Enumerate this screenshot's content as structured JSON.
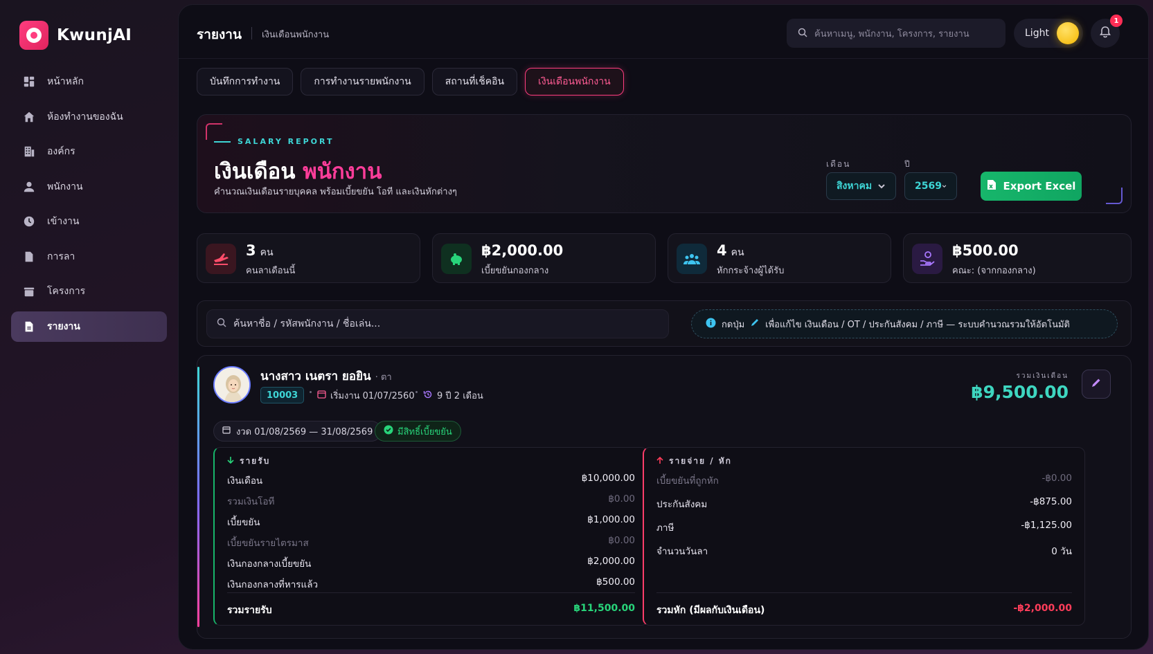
{
  "brand": {
    "name": "KwunjAI"
  },
  "sidebar": {
    "items": [
      {
        "label": "หน้าหลัก",
        "icon": "dashboard-icon"
      },
      {
        "label": "ห้องทำงานของฉัน",
        "icon": "home-icon"
      },
      {
        "label": "องค์กร",
        "icon": "building-icon"
      },
      {
        "label": "พนักงาน",
        "icon": "user-icon"
      },
      {
        "label": "เข้างาน",
        "icon": "clock-icon"
      },
      {
        "label": "การลา",
        "icon": "document-icon"
      },
      {
        "label": "โครงการ",
        "icon": "folder-icon"
      },
      {
        "label": "รายงาน",
        "icon": "report-icon",
        "active": true
      }
    ]
  },
  "header": {
    "title": "รายงาน",
    "breadcrumb": "เงินเดือนพนักงาน",
    "search_placeholder": "ค้นหาเมนู, พนักงาน, โครงการ, รายงาน",
    "theme_label": "Light",
    "notification_count": "1"
  },
  "tabs": [
    {
      "label": "บันทึกการทำงาน"
    },
    {
      "label": "การทำงานรายพนักงาน"
    },
    {
      "label": "สถานที่เช็คอิน"
    },
    {
      "label": "เงินเดือนพนักงาน",
      "active": true
    }
  ],
  "hero": {
    "eyebrow": "SALARY REPORT",
    "title_main": "เงินเดือน",
    "title_accent": "พนักงาน",
    "subtitle": "คำนวณเงินเดือนรายบุคคล พร้อมเบี้ยขยัน โอที และเงินหักต่างๆ",
    "month_label": "เดือน",
    "month_value": "สิงหาคม",
    "year_label": "ปี",
    "year_value": "2569",
    "export_label": "Export Excel",
    "accent_color": "#ff3d9a"
  },
  "stats": [
    {
      "value": "3",
      "unit": "คน",
      "label": "คนลาเดือนนี้",
      "icon": "plane-icon",
      "color": "#ff4d6a"
    },
    {
      "value": "฿2,000.00",
      "unit": "",
      "label": "เบี้ยขยันกองกลาง",
      "icon": "piggy-bank-icon",
      "color": "#28d47a"
    },
    {
      "value": "4",
      "unit": "คน",
      "label": "หักกระจ้างผู้ได้รับ",
      "icon": "users-icon",
      "color": "#3ec4f0"
    },
    {
      "value": "฿500.00",
      "unit": "",
      "label": "คณะ: (จากกองกลาง)",
      "icon": "hand-coin-icon",
      "color": "#a978ff"
    }
  ],
  "search": {
    "placeholder": "ค้นหาชื่อ / รหัสพนักงาน / ชื่อเล่น...",
    "hint_prefix": "กดปุ่ม",
    "hint_text": "เพื่อแก้ไข เงินเดือน / OT / ประกันสังคม / ภาษี — ระบบคำนวณรวมให้อัตโนมัติ"
  },
  "employee": {
    "name": "นางสาว เนตรา ยอยิน",
    "nickname": "· ตา",
    "id": "10003",
    "start_label": "เริ่มงาน 01/07/2560",
    "tenure": "9 ปี 2 เดือน",
    "total_label": "รวมเงินเดือน",
    "total_value": "฿9,500.00",
    "period": "งวด 01/08/2569 — 31/08/2569",
    "eligibility": "มีสิทธิ์เบี้ยขยัน",
    "income": {
      "title": "รายรับ",
      "rows": [
        {
          "label": "เงินเดือน",
          "value": "฿10,000.00",
          "dim": false
        },
        {
          "label": "รวมเงินโอที",
          "value": "฿0.00",
          "dim": true
        },
        {
          "label": "เบี้ยขยัน",
          "value": "฿1,000.00",
          "dim": false
        },
        {
          "label": "เบี้ยขยันรายไตรมาส",
          "value": "฿0.00",
          "dim": true
        },
        {
          "label": "เงินกองกลางเบี้ยขยัน",
          "value": "฿2,000.00",
          "dim": false
        },
        {
          "label": "เงินกองกลางที่หารแล้ว",
          "value": "฿500.00",
          "dim": false
        }
      ],
      "total_label": "รวมรายรับ",
      "total_value": "฿11,500.00"
    },
    "deduction": {
      "title": "รายจ่าย / หัก",
      "rows": [
        {
          "label": "เบี้ยขยันที่ถูกหัก",
          "value": "-฿0.00",
          "dim": true
        },
        {
          "label": "ประกันสังคม",
          "value": "-฿875.00",
          "dim": false
        },
        {
          "label": "ภาษี",
          "value": "-฿1,125.00",
          "dim": false
        },
        {
          "label": "จำนวนวันลา",
          "value": "0 วัน",
          "dim": false
        }
      ],
      "total_label": "รวมหัก (มีผลกับเงินเดือน)",
      "total_value": "-฿2,000.00"
    }
  }
}
